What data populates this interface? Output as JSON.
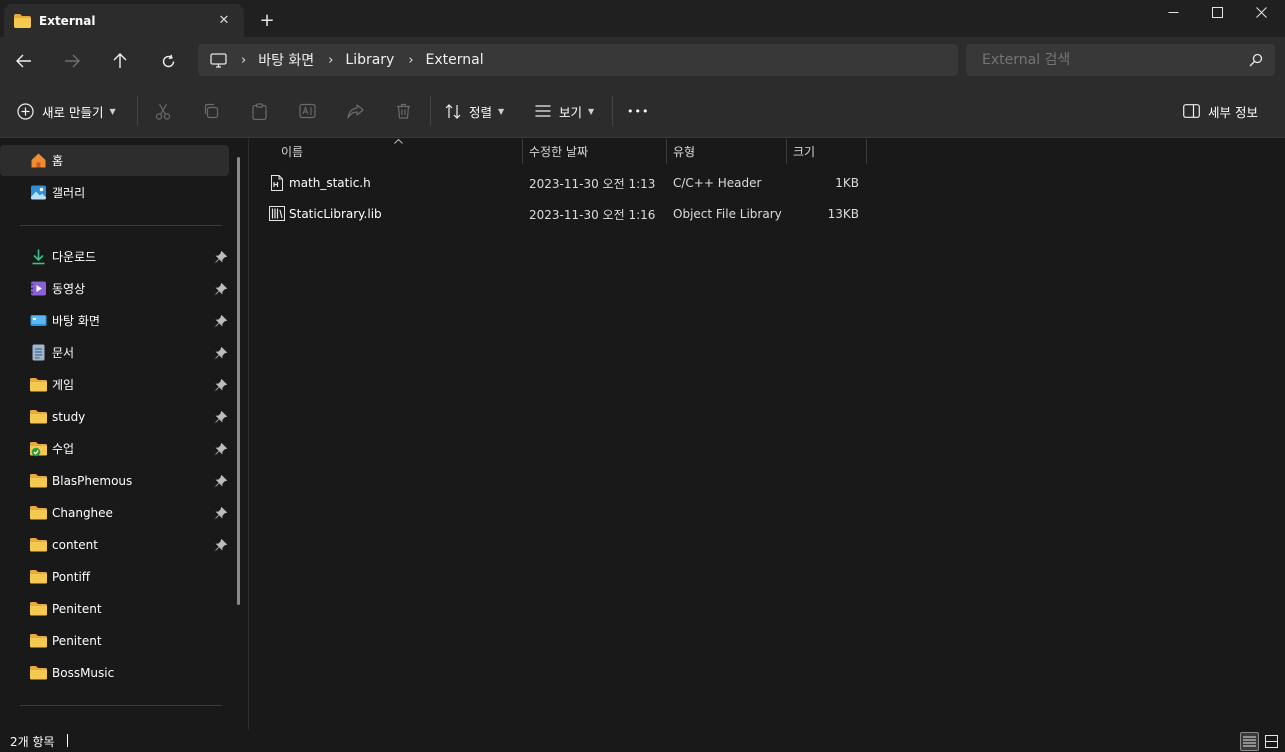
{
  "window": {
    "tab_title": "External",
    "tab_close": "✕",
    "new_tab": "+"
  },
  "address": {
    "crumbs": [
      "바탕 화면",
      "Library",
      "External"
    ]
  },
  "search": {
    "placeholder": "External 검색"
  },
  "commands": {
    "new": "새로 만들기",
    "sort": "정렬",
    "view": "보기",
    "more": "•••",
    "details": "세부 정보"
  },
  "sidebar": {
    "top": [
      {
        "label": "홈",
        "icon": "home-icon"
      },
      {
        "label": "갤러리",
        "icon": "gallery-icon"
      }
    ],
    "pinned": [
      {
        "label": "다운로드",
        "icon": "download-icon",
        "pinned": true
      },
      {
        "label": "동영상",
        "icon": "video-icon",
        "pinned": true
      },
      {
        "label": "바탕 화면",
        "icon": "desktop-icon",
        "pinned": true
      },
      {
        "label": "문서",
        "icon": "document-icon",
        "pinned": true
      },
      {
        "label": "게임",
        "icon": "folder-icon",
        "pinned": true
      },
      {
        "label": "study",
        "icon": "folder-icon",
        "pinned": true
      },
      {
        "label": "수업",
        "icon": "folder-check-icon",
        "pinned": true
      },
      {
        "label": "BlasPhemous",
        "icon": "folder-icon",
        "pinned": true
      },
      {
        "label": "Changhee",
        "icon": "folder-icon",
        "pinned": true
      },
      {
        "label": "content",
        "icon": "folder-icon",
        "pinned": true
      },
      {
        "label": "Pontiff",
        "icon": "folder-icon",
        "pinned": false
      },
      {
        "label": "Penitent",
        "icon": "folder-icon",
        "pinned": false
      },
      {
        "label": "Penitent",
        "icon": "folder-icon",
        "pinned": false
      },
      {
        "label": "BossMusic",
        "icon": "folder-icon",
        "pinned": false
      }
    ]
  },
  "columns": {
    "name": "이름",
    "date": "수정한 날짜",
    "type": "유형",
    "size": "크기"
  },
  "files": [
    {
      "name": "math_static.h",
      "date": "2023-11-30 오전 1:13",
      "type": "C/C++ Header",
      "size": "1KB",
      "icon": "header-file-icon"
    },
    {
      "name": "StaticLibrary.lib",
      "date": "2023-11-30 오전 1:16",
      "type": "Object File Library",
      "size": "13KB",
      "icon": "library-file-icon"
    }
  ],
  "status": {
    "count": "2개 항목"
  },
  "colors": {
    "folder": "#f2c14e",
    "accent": "#4cc2ff",
    "background": "#191919",
    "toolbar": "#2c2c2c"
  }
}
